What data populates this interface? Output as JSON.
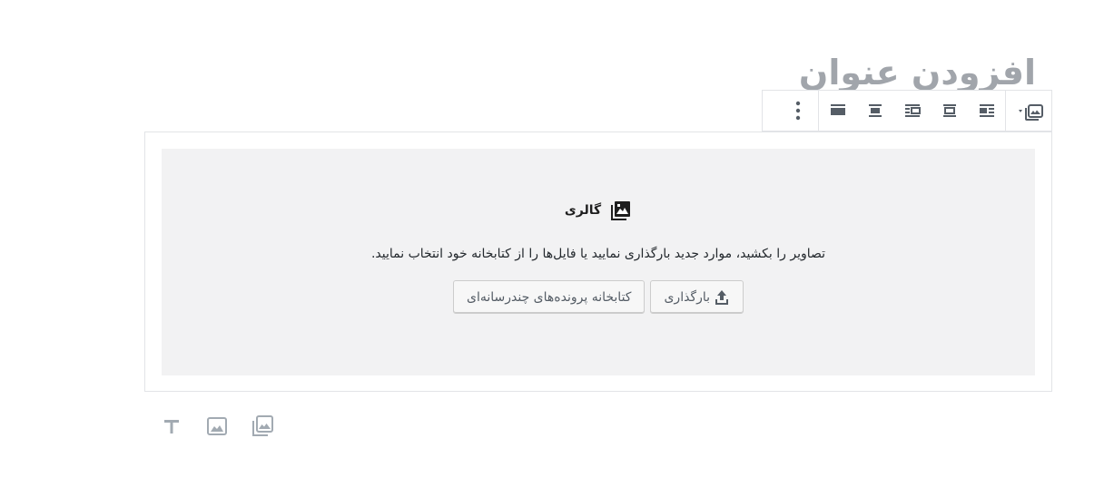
{
  "post_title": {
    "placeholder": "افزودن عنوان"
  },
  "toolbar": {
    "block_switcher_icon": "gallery-icon",
    "alignment_icons": [
      "align-full-width-icon",
      "align-wide-icon",
      "align-right-icon",
      "align-center-icon",
      "align-left-icon"
    ],
    "more_options_icon": "more-vertical-icon"
  },
  "gallery": {
    "label": "گالری",
    "instructions": "تصاویر را بکشید، موارد جدید بارگذاری نمایید یا فایل‌ها را از کتابخانه خود انتخاب نمایید.",
    "upload_button": "بارگذاری",
    "media_library_button": "کتابخانه پرونده‌های چندرسانه‌ای"
  },
  "inserter": {
    "items": [
      "paragraph-icon",
      "image-icon",
      "gallery-icon"
    ]
  },
  "colors": {
    "placeholder_bg": "#f2f2f3",
    "border": "#e2e4e7",
    "title_placeholder": "#a1a5ab",
    "icon": "#555d66",
    "muted_icon": "#a2aab2"
  }
}
